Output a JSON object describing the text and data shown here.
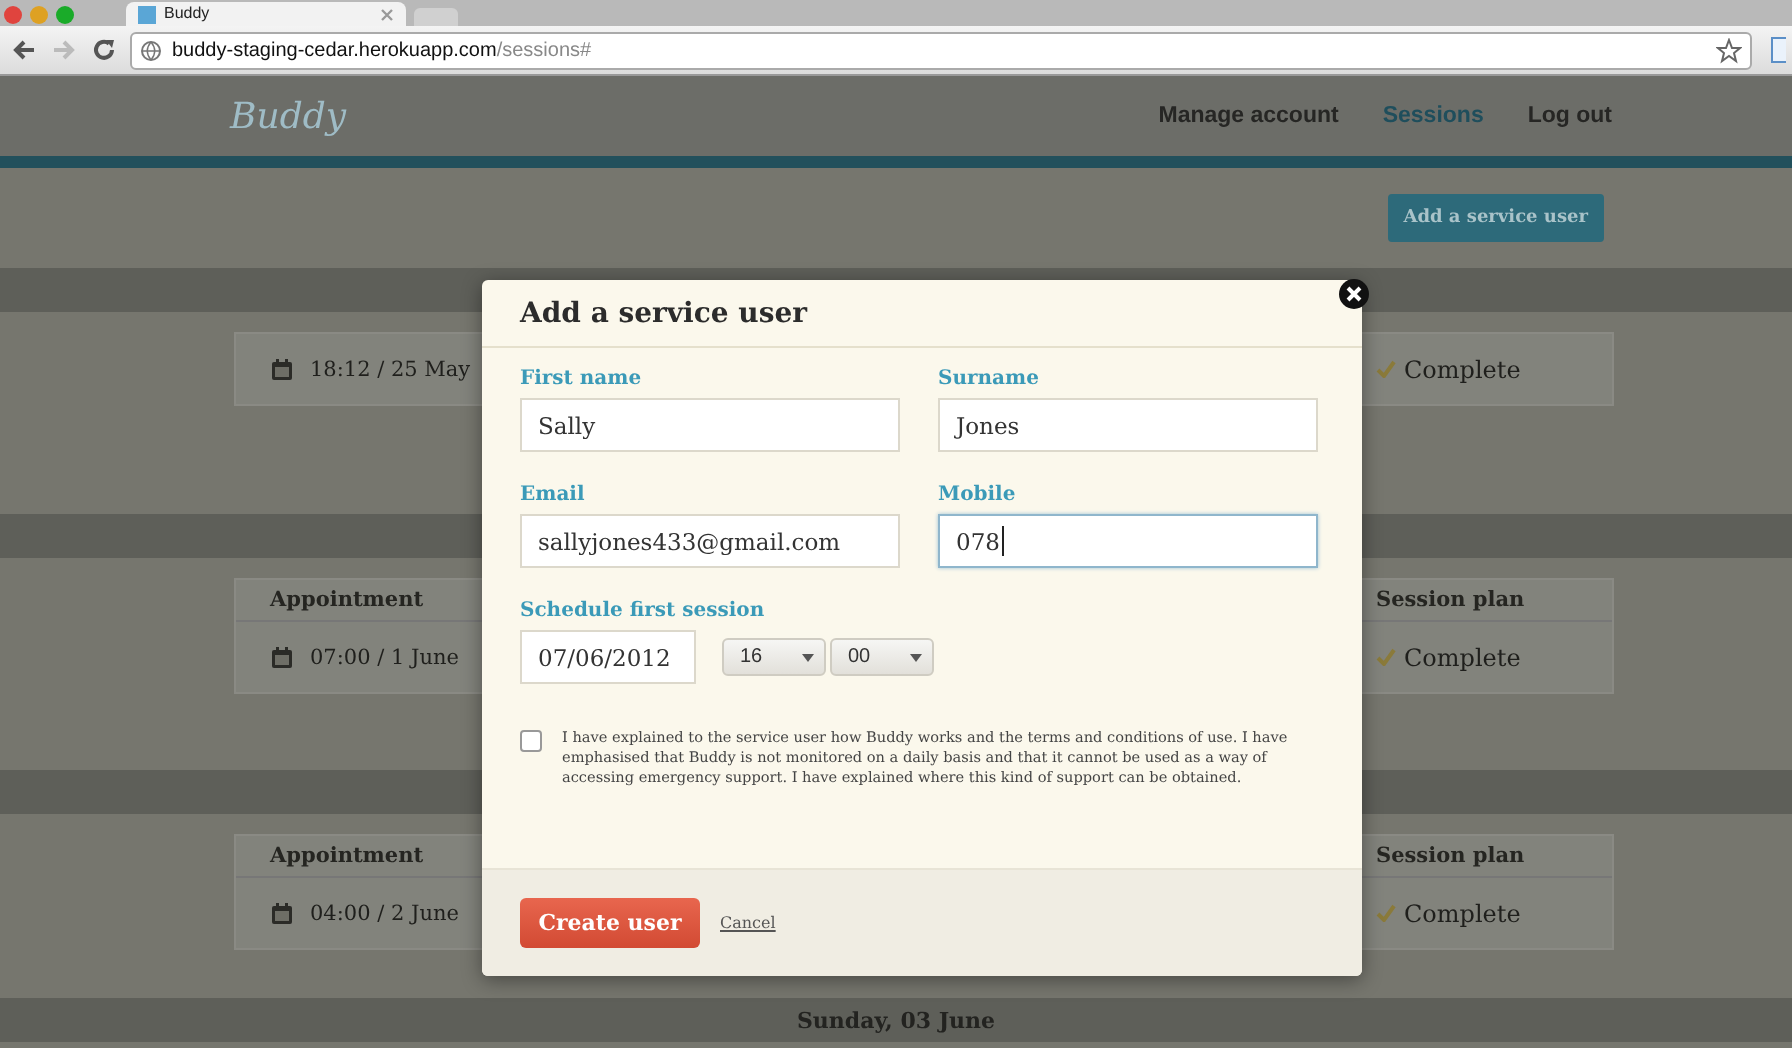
{
  "browser": {
    "tab_title": "Buddy",
    "url_host": "buddy-staging-cedar.herokuapp.com",
    "url_path": "/sessions#"
  },
  "site": {
    "logo": "Buddy",
    "nav": [
      {
        "label": "Manage account",
        "selected": false
      },
      {
        "label": "Sessions",
        "selected": true
      },
      {
        "label": "Log out",
        "selected": false
      }
    ],
    "action_button": "Add a service user"
  },
  "sessions": [
    {
      "appointment": "18:12 / 25 May",
      "plan": "Complete"
    },
    {
      "headers": [
        "Appointment",
        "Session plan"
      ],
      "appointment": "07:00 / 1 June",
      "plan": "Complete"
    },
    {
      "headers": [
        "Appointment",
        "Session plan"
      ],
      "appointment": "04:00 / 2 June",
      "plan": "Complete"
    }
  ],
  "next_day": "Sunday, 03 June",
  "modal": {
    "title": "Add a service user",
    "fields": [
      {
        "label": "First name",
        "value": "Sally",
        "focused": false
      },
      {
        "label": "Surname",
        "value": "Jones",
        "focused": false
      },
      {
        "label": "Email",
        "value": "sallyjones433@gmail.com",
        "focused": false
      },
      {
        "label": "Mobile",
        "value": "078",
        "focused": true
      }
    ],
    "schedule": {
      "label": "Schedule first session",
      "date": "07/06/2012",
      "hour": "16",
      "minute": "00"
    },
    "agreement": {
      "checked": false,
      "text": "I have explained to the service user how Buddy works and the terms and conditions of use. I have emphasised that Buddy is not monitored on a daily basis and that it cannot be used as a way of accessing emergency support. I have explained where this kind of support can be obtained."
    },
    "submit": "Create user",
    "cancel": "Cancel"
  }
}
